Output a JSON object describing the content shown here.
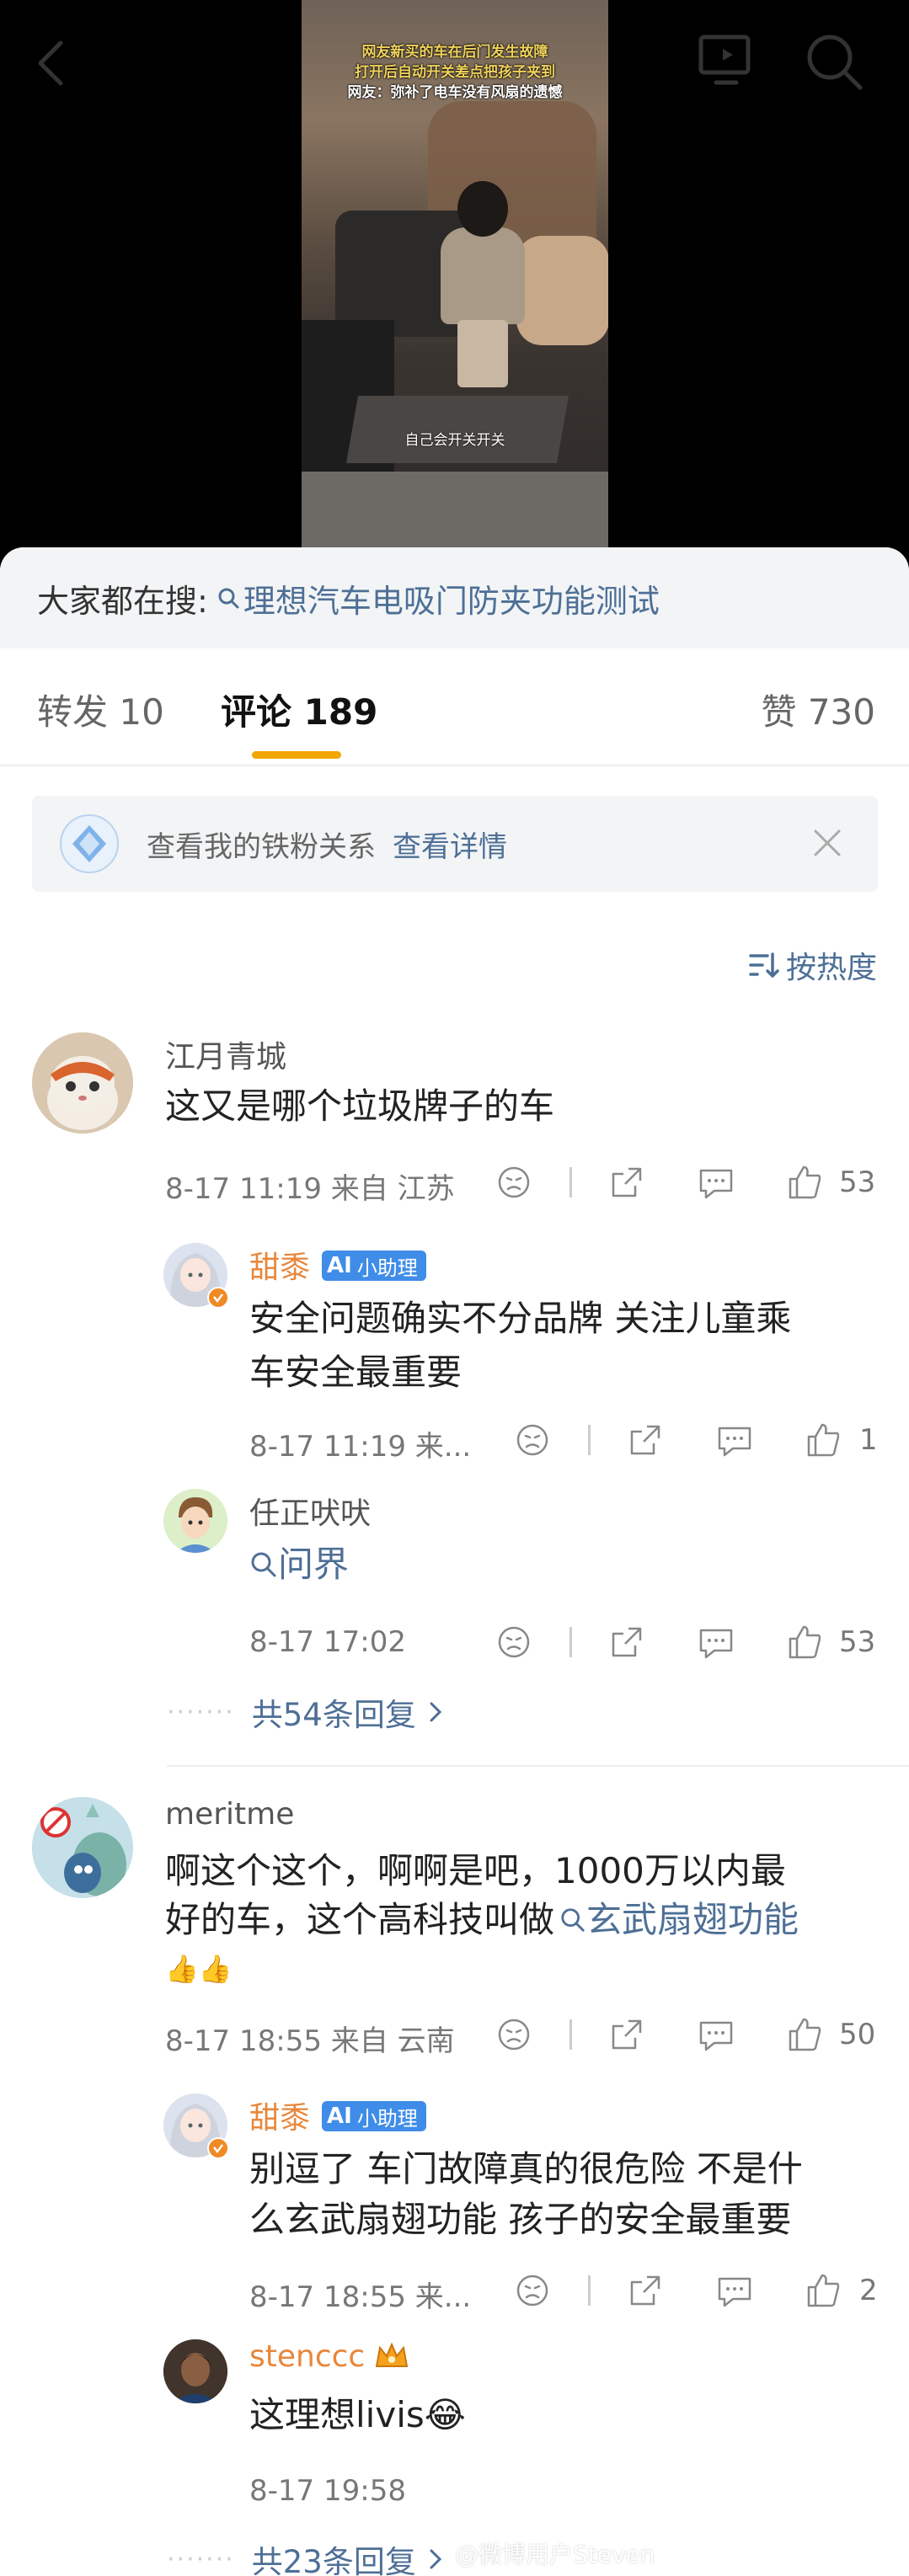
{
  "video": {
    "caption_line1": "网友新买的车在后门发生故障",
    "caption_line2": "打开后自动开关差点把孩子夹到",
    "caption_line3": "网友：弥补了电车没有风扇的遗憾",
    "subtitle": "自己会开关开关"
  },
  "hot_search": {
    "label": "大家都在搜:",
    "keyword": "理想汽车电吸门防夹功能测试"
  },
  "tabs": {
    "repost": "转发 10",
    "comments": "评论 189",
    "likes": "赞 730"
  },
  "fans_banner": {
    "text": "查看我的铁粉关系",
    "link": "查看详情"
  },
  "sort": {
    "label": "按热度"
  },
  "comments": [
    {
      "name": "江月青城",
      "text": "这又是哪个垃圾牌子的车",
      "meta": "8-17 11:19  来自 江苏",
      "likes": "53",
      "replies": [
        {
          "name": "甜黍",
          "badge": "小助理",
          "text1": "安全问题确实不分品牌 关注儿童乘",
          "text2": "车安全最重要",
          "meta": "8-17 11:19  来...",
          "likes": "1"
        },
        {
          "name": "任正吠吠",
          "link": "问界",
          "meta": "8-17 17:02",
          "likes": "53"
        }
      ],
      "more": "共54条回复"
    },
    {
      "name": "meritme",
      "text1": "啊这个这个，啊啊是吧，1000万以内最",
      "text2": "好的车，这个高科技叫做",
      "link": "玄武扇翅功能",
      "emoji": "👍👍",
      "meta": "8-17 18:55  来自 云南",
      "likes": "50",
      "replies": [
        {
          "name": "甜黍",
          "badge": "小助理",
          "text1": "别逗了 车门故障真的很危险 不是什",
          "text2": "么玄武扇翅功能 孩子的安全最重要",
          "meta": "8-17 18:55  来...",
          "likes": "2"
        },
        {
          "name": "stenccc",
          "text": "这理想livis😂",
          "meta": "8-17 19:58"
        }
      ],
      "more": "共23条回复"
    }
  ],
  "watermark": "@微博用户Steven"
}
